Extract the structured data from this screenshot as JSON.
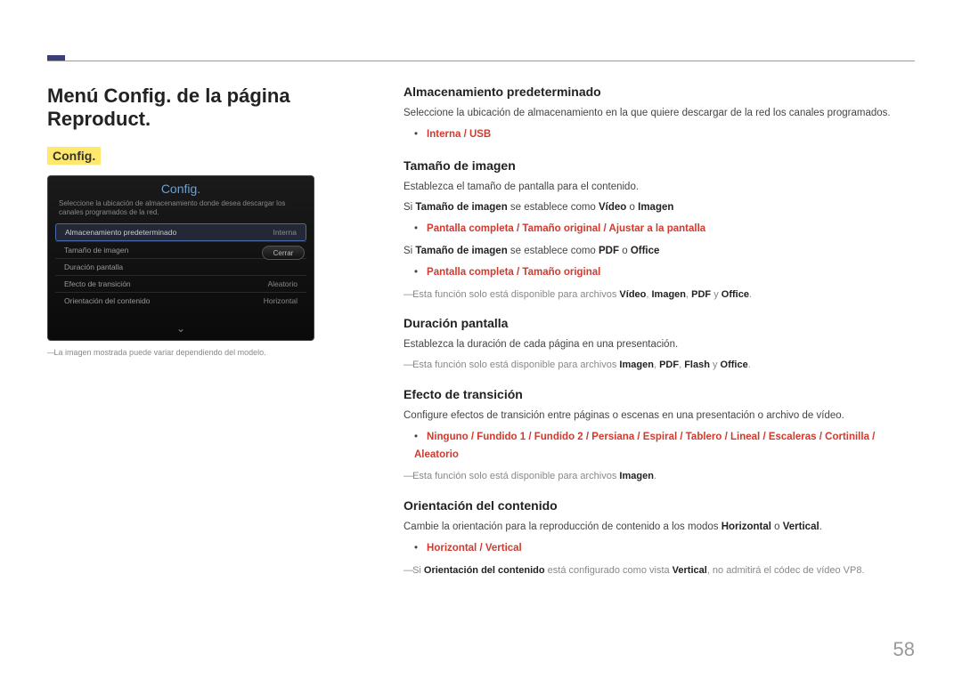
{
  "page_number": "58",
  "left": {
    "h1": "Menú Config. de la página Reproduct.",
    "config_label": "Config.",
    "ss_title": "Config.",
    "ss_desc": "Seleccione la ubicación de almacenamiento donde desea descargar los canales programados de la red.",
    "ss_rows": [
      {
        "label": "Almacenamiento predeterminado",
        "value": "Interna",
        "selected": true
      },
      {
        "label": "Tamaño de imagen",
        "value": ""
      },
      {
        "label": "Duración pantalla",
        "value": ""
      },
      {
        "label": "Efecto de transición",
        "value": "Aleatorio"
      },
      {
        "label": "Orientación del contenido",
        "value": "Horizontal"
      }
    ],
    "ss_close": "Cerrar",
    "img_note": "La imagen mostrada puede variar dependiendo del modelo."
  },
  "s1": {
    "h": "Almacenamiento predeterminado",
    "p1": "Seleccione la ubicación de almacenamiento en la que quiere descargar de la red los canales programados.",
    "opt": "Interna / USB"
  },
  "s2": {
    "h": "Tamaño de imagen",
    "p1": "Establezca el tamaño de pantalla para el contenido.",
    "p2a": "Si ",
    "p2b": "Tamaño de imagen",
    "p2c": " se establece como ",
    "p2d": "Vídeo",
    "p2e": " o ",
    "p2f": "Imagen",
    "opt1": "Pantalla completa / Tamaño original / Ajustar a la pantalla",
    "p3a": "Si ",
    "p3b": "Tamaño de imagen",
    "p3c": " se establece como ",
    "p3d": "PDF",
    "p3e": " o ",
    "p3f": "Office",
    "opt2": "Pantalla completa / Tamaño original",
    "note_a": "Esta función solo está disponible para archivos ",
    "note_b": "Vídeo",
    "note_c": ", ",
    "note_d": "Imagen",
    "note_e": ", ",
    "note_f": "PDF",
    "note_g": " y ",
    "note_h": "Office",
    "note_i": "."
  },
  "s3": {
    "h": "Duración pantalla",
    "p1": "Establezca la duración de cada página en una presentación.",
    "note_a": "Esta función solo está disponible para archivos ",
    "note_b": "Imagen",
    "note_c": ", ",
    "note_d": "PDF",
    "note_e": ", ",
    "note_f": "Flash",
    "note_g": " y ",
    "note_h": "Office",
    "note_i": "."
  },
  "s4": {
    "h": "Efecto de transición",
    "p1": "Configure efectos de transición entre páginas o escenas en una presentación o archivo de vídeo.",
    "opt": "Ninguno / Fundido 1 / Fundido 2 / Persiana / Espiral / Tablero / Lineal / Escaleras / Cortinilla / Aleatorio",
    "note_a": "Esta función solo está disponible para archivos ",
    "note_b": "Imagen",
    "note_c": "."
  },
  "s5": {
    "h": "Orientación del contenido",
    "p1a": "Cambie la orientación para la reproducción de contenido a los modos ",
    "p1b": "Horizontal",
    "p1c": " o ",
    "p1d": "Vertical",
    "p1e": ".",
    "opt": "Horizontal / Vertical",
    "note_a": "Si ",
    "note_b": "Orientación del contenido",
    "note_c": " está configurado como vista ",
    "note_d": "Vertical",
    "note_e": ", no admitirá el códec de vídeo VP8."
  }
}
